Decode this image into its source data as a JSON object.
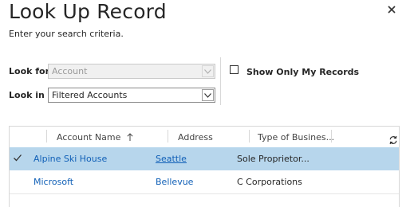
{
  "dialog": {
    "title": "Look Up Record",
    "subtitle": "Enter your search criteria."
  },
  "form": {
    "look_for_label": "Look for",
    "look_for_value": "Account",
    "look_in_label": "Look in",
    "look_in_value": "Filtered Accounts",
    "show_only_my_records_label": "Show Only My Records",
    "show_only_my_records_checked": false
  },
  "grid": {
    "columns": [
      {
        "label": "Account Name",
        "sort": "ascending"
      },
      {
        "label": "Address"
      },
      {
        "label": "Type of Busines..."
      }
    ],
    "rows": [
      {
        "selected": true,
        "account_name": "Alpine Ski House",
        "address": "Seattle",
        "type": "Sole Proprietor..."
      },
      {
        "selected": false,
        "account_name": "Microsoft",
        "address": "Bellevue",
        "type": "C Corporations"
      }
    ]
  },
  "icons": {
    "close": "close-icon",
    "dropdown": "chevron-down-icon",
    "sort": "sort-ascending-icon",
    "checkmark": "checkmark-icon",
    "refresh": "refresh-icon"
  },
  "colors": {
    "selected_row": "#b7d6ec",
    "link": "#1160b7"
  }
}
